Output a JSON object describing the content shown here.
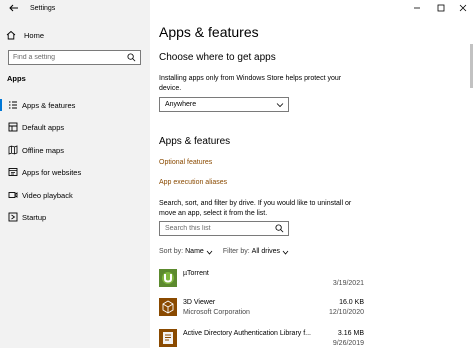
{
  "window": {
    "title": "Settings",
    "controls": [
      "minimize-icon",
      "maximize-icon",
      "close-icon"
    ]
  },
  "sidebar": {
    "home_label": "Home",
    "search_placeholder": "Find a setting",
    "section_title": "Apps",
    "items": [
      {
        "label": "Apps & features",
        "icon": "apps-list-icon",
        "selected": true
      },
      {
        "label": "Default apps",
        "icon": "default-apps-icon",
        "selected": false
      },
      {
        "label": "Offline maps",
        "icon": "map-icon",
        "selected": false
      },
      {
        "label": "Apps for websites",
        "icon": "apps-websites-icon",
        "selected": false
      },
      {
        "label": "Video playback",
        "icon": "video-icon",
        "selected": false
      },
      {
        "label": "Startup",
        "icon": "startup-icon",
        "selected": false
      }
    ]
  },
  "main": {
    "page_title": "Apps & features",
    "choose": {
      "heading": "Choose where to get apps",
      "description": "Installing apps only from Windows Store helps protect your device.",
      "description_line1": "Installing apps only from Windows Store helps protect your",
      "description_line2": "device.",
      "selected_option": "Anywhere"
    },
    "apps_features": {
      "heading": "Apps & features",
      "optional_features_link": "Optional features",
      "execution_aliases_link": "App execution aliases",
      "description_line1": "Search, sort, and filter by drive. If you would like to uninstall or",
      "description_line2": "move an app, select it from the list.",
      "search_placeholder": "Search this list",
      "sort_label": "Sort by:",
      "sort_value": "Name",
      "filter_label": "Filter by:",
      "filter_value": "All drives"
    },
    "apps": [
      {
        "name": "µTorrent",
        "publisher": "",
        "size": "",
        "date": "3/19/2021",
        "icon": "utorrent-icon"
      },
      {
        "name": "3D Viewer",
        "publisher": "Microsoft Corporation",
        "size": "16.0 KB",
        "date": "12/10/2020",
        "icon": "3d-viewer-icon"
      },
      {
        "name": "Active Directory Authentication Library f...",
        "publisher": "",
        "size": "3.16 MB",
        "date": "9/26/2019",
        "icon": "installer-icon"
      }
    ]
  },
  "colors": {
    "accent": "#0078d7",
    "link": "#8a4a00",
    "sidebar_bg": "#f2f2f2"
  }
}
